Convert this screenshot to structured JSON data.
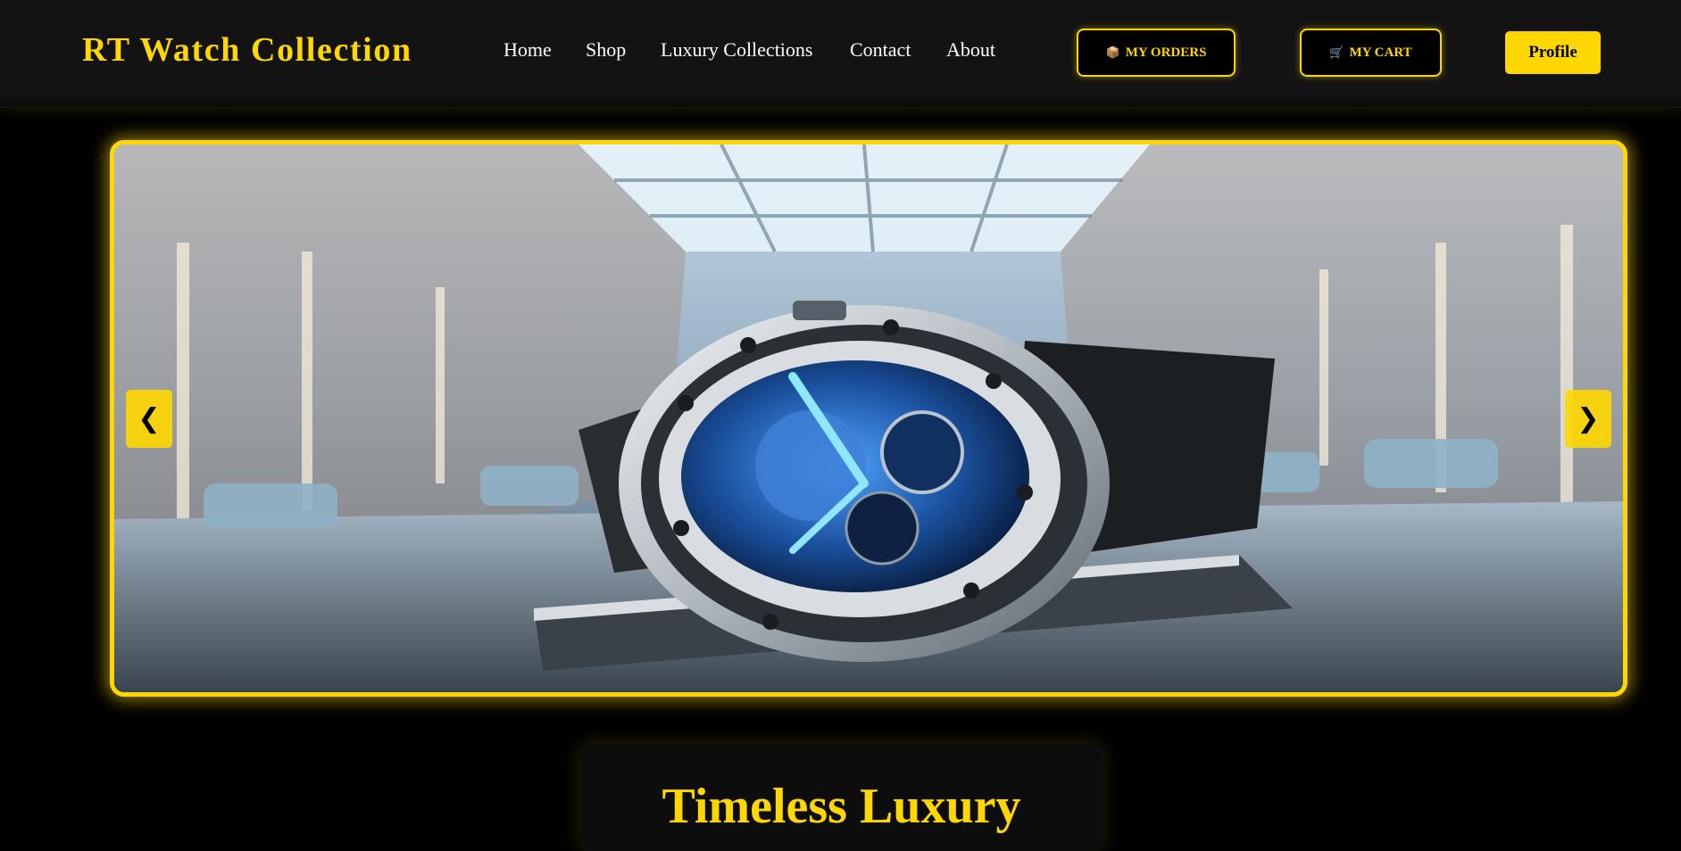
{
  "brand": {
    "name": "RT Watch Collection"
  },
  "nav": {
    "links": [
      "Home",
      "Shop",
      "Luxury Collections",
      "Contact",
      "About"
    ],
    "orders_label": "MY ORDERS",
    "cart_label": "MY CART",
    "profile_label": "Profile"
  },
  "icons": {
    "orders_icon": "📦",
    "cart_icon": "🛒",
    "prev_arrow": "❮",
    "next_arrow": "❯"
  },
  "slider": {
    "image_alt": "Luxury skeleton watch with blue dial on a marble pedestal in a modern showroom"
  },
  "hero": {
    "title": "Timeless Luxury"
  },
  "colors": {
    "accent": "#ffd700",
    "background": "#000000",
    "navbar": "#141414"
  }
}
